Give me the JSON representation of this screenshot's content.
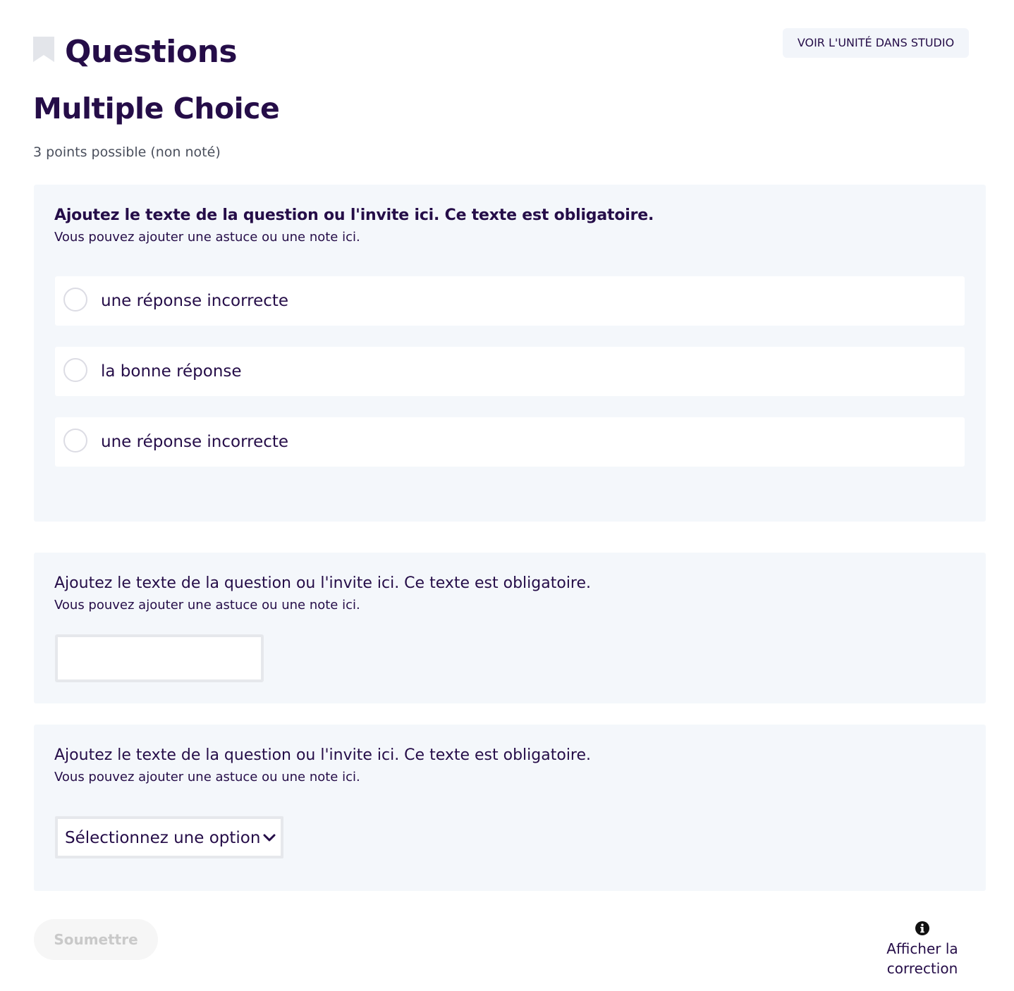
{
  "header": {
    "title": "Questions",
    "studio_button_label": "VOIR L'UNITÉ DANS STUDIO"
  },
  "problem": {
    "title": "Multiple Choice",
    "points": "3 points possible (non noté)"
  },
  "question1": {
    "prompt": "Ajoutez le texte de la question ou l'invite ici. Ce texte est obligatoire.",
    "hint": "Vous pouvez ajouter une astuce ou une note ici.",
    "choices": [
      {
        "label": "une réponse incorrecte"
      },
      {
        "label": "la bonne réponse"
      },
      {
        "label": "une réponse incorrecte"
      }
    ]
  },
  "question2": {
    "prompt": "Ajoutez le texte de la question ou l'invite ici. Ce texte est obligatoire.",
    "hint": "Vous pouvez ajouter une astuce ou une note ici.",
    "input_value": ""
  },
  "question3": {
    "prompt": "Ajoutez le texte de la question ou l'invite ici. Ce texte est obligatoire.",
    "hint": "Vous pouvez ajouter une astuce ou une note ici.",
    "select_value": "Sélectionnez une option"
  },
  "actions": {
    "submit_label": "Soumettre",
    "show_answer_label": "Afficher la correction"
  },
  "icons": {
    "bookmark": "bookmark-icon",
    "chevron": "chevron-down-icon",
    "info": "info-icon"
  },
  "colors": {
    "primary_text": "#250d48",
    "card_background": "#f4f7fb",
    "button_background": "#f2f5fa",
    "disabled_text": "#c9c9c9"
  }
}
